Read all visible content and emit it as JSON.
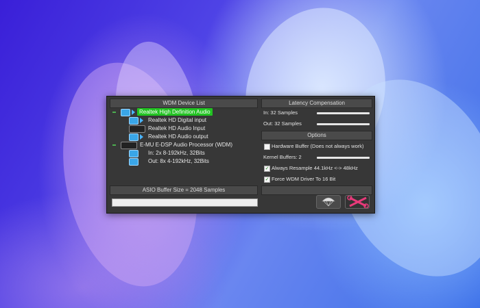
{
  "wdm": {
    "title": "WDM Device List",
    "devices": [
      {
        "label": "Realtek High Definition Audio",
        "icon": "speaker-icon"
      },
      {
        "label": "Realtek HD Digital input",
        "icon": "speaker-icon"
      },
      {
        "label": "Realtek HD Audio Input",
        "icon": "power-icon"
      },
      {
        "label": "Realtek HD Audio output",
        "icon": "speaker-icon"
      },
      {
        "label": "E-MU E-DSP Audio Processor (WDM)",
        "icon": "power-icon"
      },
      {
        "label": "In:  2x 8-192kHz, 32Bits",
        "icon": "speaker-icon"
      },
      {
        "label": "Out: 8x 4-192kHz, 32Bits",
        "icon": "speaker-icon"
      }
    ]
  },
  "latency": {
    "title": "Latency Compensation",
    "in_label": "In:  32 Samples",
    "out_label": "Out: 32 Samples"
  },
  "options": {
    "title": "Options",
    "hardware_buffer": {
      "label": "Hardware Buffer (Does not always work)",
      "checked": false
    },
    "kernel_buffers_label": "Kernel Buffers: 2",
    "always_resample": {
      "label": "Always Resample 44.1kHz <-> 48kHz",
      "checked": true
    },
    "force_wdm": {
      "label": "Force WDM Driver To 16 Bit",
      "checked": true
    }
  },
  "asio": {
    "label": "ASIO Buffer Size = 2048 Samples"
  },
  "colors": {
    "selected": "#22c322",
    "accent": "#3aa6e8",
    "panel": "#373737"
  },
  "buttons": {
    "parachute_icon": "parachute-icon",
    "tools_icon": "wrench-screwdriver-icon"
  }
}
